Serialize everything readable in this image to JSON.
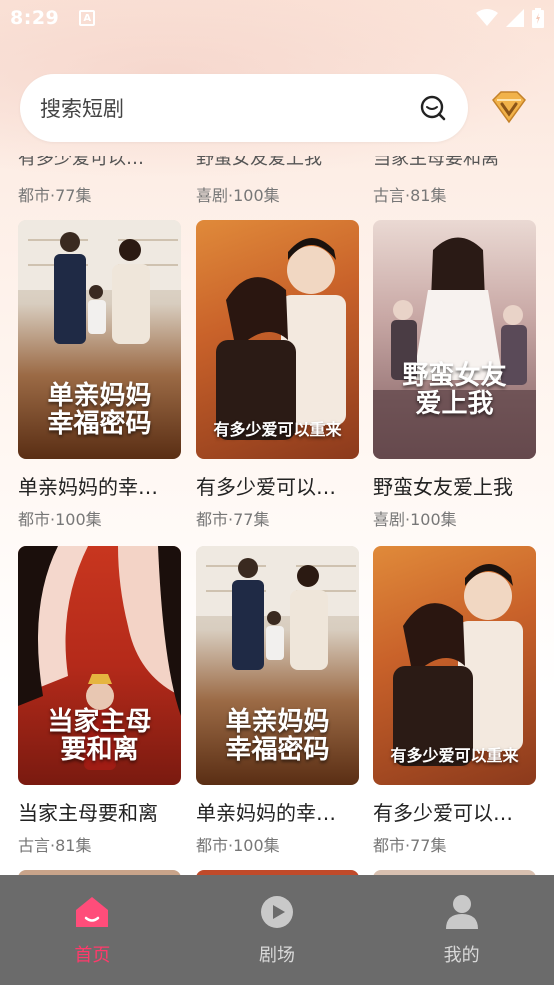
{
  "status_bar": {
    "time": "8:29",
    "a_icon": "A"
  },
  "search": {
    "placeholder": "搜索短剧"
  },
  "partial_row": [
    {
      "title": "有多少爱可以…",
      "meta": "都市·77集"
    },
    {
      "title": "野蛮女友爱上我",
      "meta": "喜剧·100集"
    },
    {
      "title": "当家主母要和离",
      "meta": "古言·81集"
    }
  ],
  "grid": [
    {
      "title": "单亲妈妈的幸…",
      "meta": "都市·100集",
      "poster_text": "单亲妈妈\n幸福密码",
      "poster_style": "family"
    },
    {
      "title": "有多少爱可以…",
      "meta": "都市·77集",
      "poster_text": "有多少爱可以重来",
      "poster_style": "warm"
    },
    {
      "title": "野蛮女友爱上我",
      "meta": "喜剧·100集",
      "poster_text": "野蛮女友\n爱上我",
      "poster_style": "wedding"
    },
    {
      "title": "当家主母要和离",
      "meta": "古言·81集",
      "poster_text": "当家主母\n要和离",
      "poster_style": "red"
    },
    {
      "title": "单亲妈妈的幸…",
      "meta": "都市·100集",
      "poster_text": "单亲妈妈\n幸福密码",
      "poster_style": "family"
    },
    {
      "title": "有多少爱可以…",
      "meta": "都市·77集",
      "poster_text": "有多少爱可以重来",
      "poster_style": "warm"
    }
  ],
  "tabbar": {
    "items": [
      {
        "label": "首页",
        "icon": "home-icon",
        "active": true
      },
      {
        "label": "剧场",
        "icon": "play-icon",
        "active": false
      },
      {
        "label": "我的",
        "icon": "user-icon",
        "active": false
      }
    ]
  },
  "colors": {
    "accent": "#ff3a6b",
    "tabbar_bg": "#6b6b6b",
    "vip_gold": "#e8a53a"
  }
}
